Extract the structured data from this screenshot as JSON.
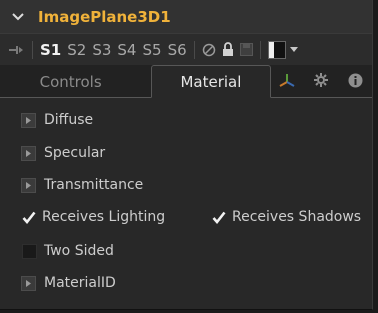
{
  "node": {
    "title": "ImagePlane3D1",
    "title_color": "#f0b23a"
  },
  "toolbar": {
    "slots": [
      "S1",
      "S2",
      "S3",
      "S4",
      "S5",
      "S6"
    ],
    "active_slot": "S1"
  },
  "tabs": {
    "controls": "Controls",
    "material": "Material",
    "active": "Material"
  },
  "sections": {
    "diffuse": "Diffuse",
    "specular": "Specular",
    "transmittance": "Transmittance",
    "material_id": "MaterialID"
  },
  "options": {
    "receives_lighting": {
      "label": "Receives Lighting",
      "checked": true
    },
    "receives_shadows": {
      "label": "Receives Shadows",
      "checked": true
    },
    "two_sided": {
      "label": "Two Sided",
      "checked": false
    }
  },
  "colors": {
    "panel_bg": "#282828",
    "title_bar_bg": "#323232",
    "text": "#cdcdcd"
  }
}
